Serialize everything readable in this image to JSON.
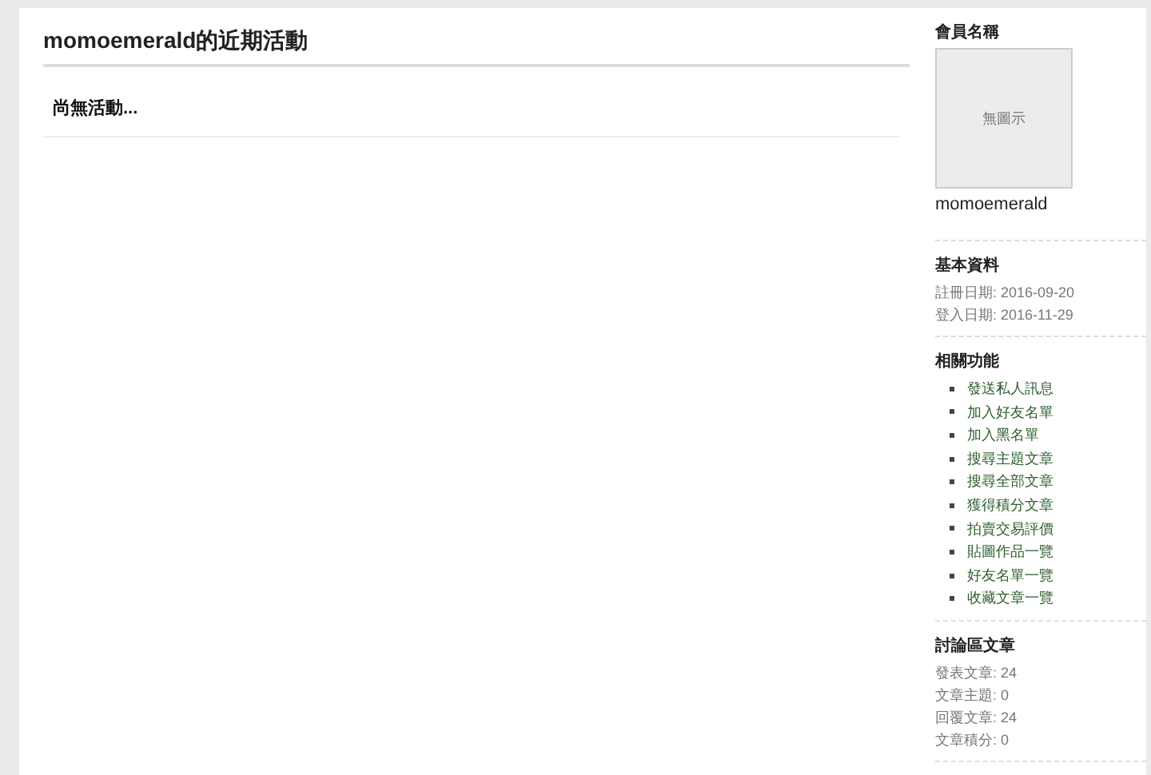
{
  "main": {
    "title": "momoemerald的近期活動",
    "empty_message": "尚無活動..."
  },
  "sidebar": {
    "member": {
      "heading": "會員名稱",
      "avatar_placeholder": "無圖示",
      "username": "momoemerald"
    },
    "basic_info": {
      "heading": "基本資料",
      "lines": [
        "註冊日期: 2016-09-20",
        "登入日期: 2016-11-29"
      ]
    },
    "functions": {
      "heading": "相關功能",
      "links": [
        "發送私人訊息",
        "加入好友名單",
        "加入黑名單",
        "搜尋主題文章",
        "搜尋全部文章",
        "獲得積分文章",
        "拍賣交易評價",
        "貼圖作品一覽",
        "好友名單一覽",
        "收藏文章一覽"
      ]
    },
    "forum_posts": {
      "heading": "討論區文章",
      "lines": [
        "發表文章: 24",
        "文章主題: 0",
        "回覆文章: 24",
        "文章積分: 0"
      ]
    }
  }
}
